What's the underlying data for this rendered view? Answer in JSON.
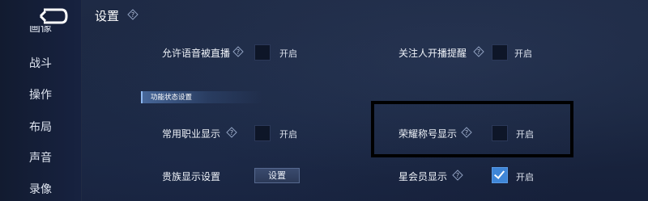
{
  "header": {
    "title": "设置"
  },
  "sidebar": {
    "items": [
      {
        "label": "画像",
        "partial": true
      },
      {
        "label": "战斗"
      },
      {
        "label": "操作"
      },
      {
        "label": "布局"
      },
      {
        "label": "声音"
      },
      {
        "label": "录像"
      }
    ]
  },
  "settings": {
    "allow_voice_broadcast": {
      "label": "允许语音被直播",
      "toggle_text": "开启",
      "checked": false
    },
    "follow_live_reminder": {
      "label": "关注人开播提醒",
      "toggle_text": "开启",
      "checked": false
    },
    "section_feature_status": {
      "label": "功能状态设置"
    },
    "common_job_display": {
      "label": "常用职业显示",
      "toggle_text": "开启",
      "checked": false
    },
    "honor_title_display": {
      "label": "荣耀称号显示",
      "toggle_text": "开启",
      "checked": false
    },
    "noble_display_settings": {
      "label": "贵族显示设置",
      "button_label": "设置"
    },
    "star_member_display": {
      "label": "星会员显示",
      "toggle_text": "开启",
      "checked": true
    }
  },
  "icons": {
    "back": "back-arrow-icon",
    "help": "help-diamond-icon"
  },
  "colors": {
    "background": "#1a2640",
    "checkbox_checked": "#3f86d8",
    "annotation_box": "#000000"
  }
}
